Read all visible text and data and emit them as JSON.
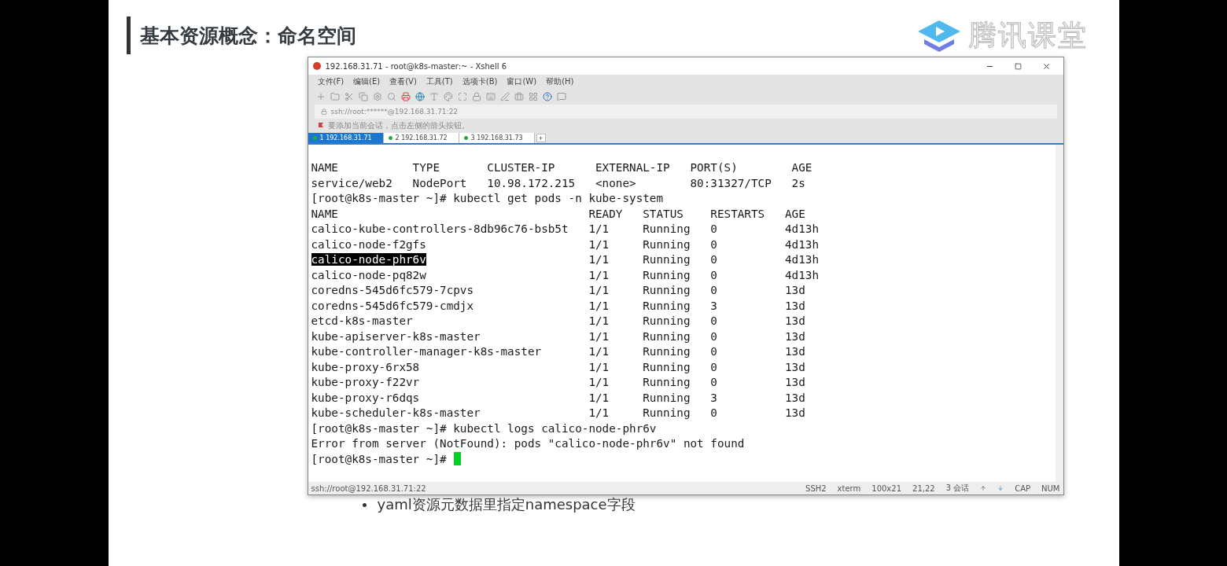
{
  "slide": {
    "title": "基本资源概念：命名空间",
    "logo_text": "腾讯课堂",
    "bullet": "yaml资源元数据里指定namespace字段"
  },
  "window": {
    "title": "192.168.31.71 - root@k8s-master:~ - Xshell 6",
    "menu": [
      "文件(F)",
      "编辑(E)",
      "查看(V)",
      "工具(T)",
      "选项卡(B)",
      "窗口(W)",
      "帮助(H)"
    ],
    "address": "ssh://root:******@192.168.31.71:22",
    "hint": "要添加当前会话，点击左侧的箭头按钮。",
    "tabs": [
      {
        "label": "1 192.168.31.71",
        "selected": true
      },
      {
        "label": "2 192.168.31.72",
        "selected": false
      },
      {
        "label": "3 192.168.31.73",
        "selected": false
      }
    ],
    "tab_add": "+"
  },
  "terminal": {
    "service_table": {
      "columns": [
        "NAME",
        "TYPE",
        "CLUSTER-IP",
        "EXTERNAL-IP",
        "PORT(S)",
        "AGE"
      ],
      "rows": [
        [
          "service/web2",
          "NodePort",
          "10.98.172.215",
          "<none>",
          "80:31327/TCP",
          "2s"
        ]
      ]
    },
    "command_1": "[root@k8s-master ~]# kubectl get pods -n kube-system",
    "pod_table": {
      "columns": [
        "NAME",
        "READY",
        "STATUS",
        "RESTARTS",
        "AGE"
      ],
      "rows": [
        {
          "cells": [
            "calico-kube-controllers-8db96c76-bsb5t",
            "1/1",
            "Running",
            "0",
            "4d13h"
          ],
          "selected": false
        },
        {
          "cells": [
            "calico-node-f2gfs",
            "1/1",
            "Running",
            "0",
            "4d13h"
          ],
          "selected": false
        },
        {
          "cells": [
            "calico-node-phr6v",
            "1/1",
            "Running",
            "0",
            "4d13h"
          ],
          "selected": true
        },
        {
          "cells": [
            "calico-node-pq82w",
            "1/1",
            "Running",
            "0",
            "4d13h"
          ],
          "selected": false
        },
        {
          "cells": [
            "coredns-545d6fc579-7cpvs",
            "1/1",
            "Running",
            "0",
            "13d"
          ],
          "selected": false
        },
        {
          "cells": [
            "coredns-545d6fc579-cmdjx",
            "1/1",
            "Running",
            "3",
            "13d"
          ],
          "selected": false
        },
        {
          "cells": [
            "etcd-k8s-master",
            "1/1",
            "Running",
            "0",
            "13d"
          ],
          "selected": false
        },
        {
          "cells": [
            "kube-apiserver-k8s-master",
            "1/1",
            "Running",
            "0",
            "13d"
          ],
          "selected": false
        },
        {
          "cells": [
            "kube-controller-manager-k8s-master",
            "1/1",
            "Running",
            "0",
            "13d"
          ],
          "selected": false
        },
        {
          "cells": [
            "kube-proxy-6rx58",
            "1/1",
            "Running",
            "0",
            "13d"
          ],
          "selected": false
        },
        {
          "cells": [
            "kube-proxy-f22vr",
            "1/1",
            "Running",
            "0",
            "13d"
          ],
          "selected": false
        },
        {
          "cells": [
            "kube-proxy-r6dqs",
            "1/1",
            "Running",
            "3",
            "13d"
          ],
          "selected": false
        },
        {
          "cells": [
            "kube-scheduler-k8s-master",
            "1/1",
            "Running",
            "0",
            "13d"
          ],
          "selected": false
        }
      ]
    },
    "command_2": "[root@k8s-master ~]# kubectl logs calico-node-phr6v",
    "error": "Error from server (NotFound): pods \"calico-node-phr6v\" not found",
    "prompt": "[root@k8s-master ~]#"
  },
  "status_bar": {
    "connection": "ssh://root@192.168.31.71:22",
    "items": [
      "SSH2",
      "xterm",
      "100x21",
      "21,22",
      "3 会话",
      "CAP",
      "NUM"
    ]
  }
}
